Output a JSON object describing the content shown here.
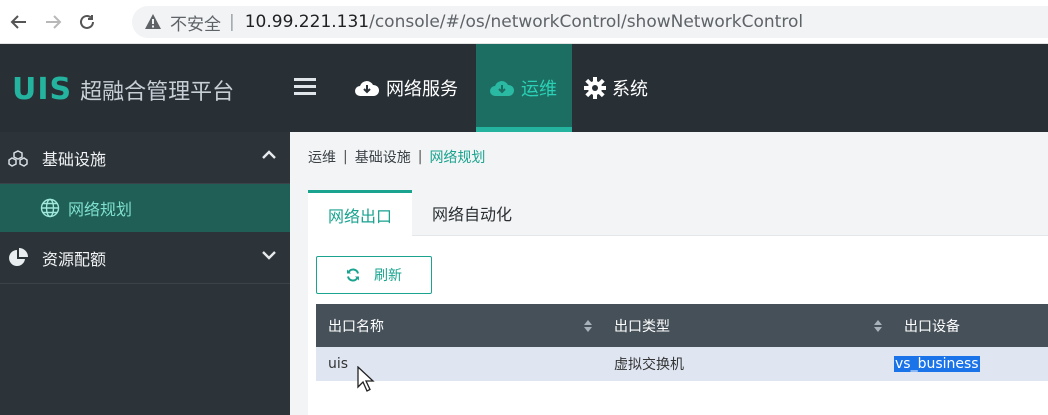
{
  "browser": {
    "insecure_label": "不安全",
    "url_host": "10.99.221.131",
    "url_path": "/console/#/os/networkControl/showNetworkControl"
  },
  "header": {
    "logo_mark": "UIS",
    "logo_text": "超融合管理平台",
    "nav": [
      {
        "label": "网络服务",
        "icon": "cloud-icon",
        "active": false
      },
      {
        "label": "运维",
        "icon": "cloud-icon",
        "active": true
      },
      {
        "label": "系统",
        "icon": "gear-icon",
        "active": false
      }
    ]
  },
  "sidebar": {
    "groups": [
      {
        "label": "基础设施",
        "icon": "infrastructure-icon",
        "expanded": true,
        "items": [
          {
            "label": "网络规划",
            "icon": "globe-icon",
            "active": true
          }
        ]
      },
      {
        "label": "资源配额",
        "icon": "pie-chart-icon",
        "expanded": false
      }
    ]
  },
  "breadcrumb": {
    "items": [
      "运维",
      "基础设施",
      "网络规划"
    ],
    "separator": "|"
  },
  "tabs": [
    {
      "label": "网络出口",
      "active": true
    },
    {
      "label": "网络自动化",
      "active": false
    }
  ],
  "toolbar": {
    "refresh_label": "刷新"
  },
  "table": {
    "columns": [
      "出口名称",
      "出口类型",
      "出口设备"
    ],
    "rows": [
      {
        "name": "uis",
        "type": "虚拟交换机",
        "device": "vs_business"
      }
    ]
  },
  "colors": {
    "accent": "#1aa38f",
    "header_bg": "#282f35",
    "sidebar_bg": "#2c343a",
    "table_head_bg": "#465059",
    "selection": "#1a73e8"
  }
}
